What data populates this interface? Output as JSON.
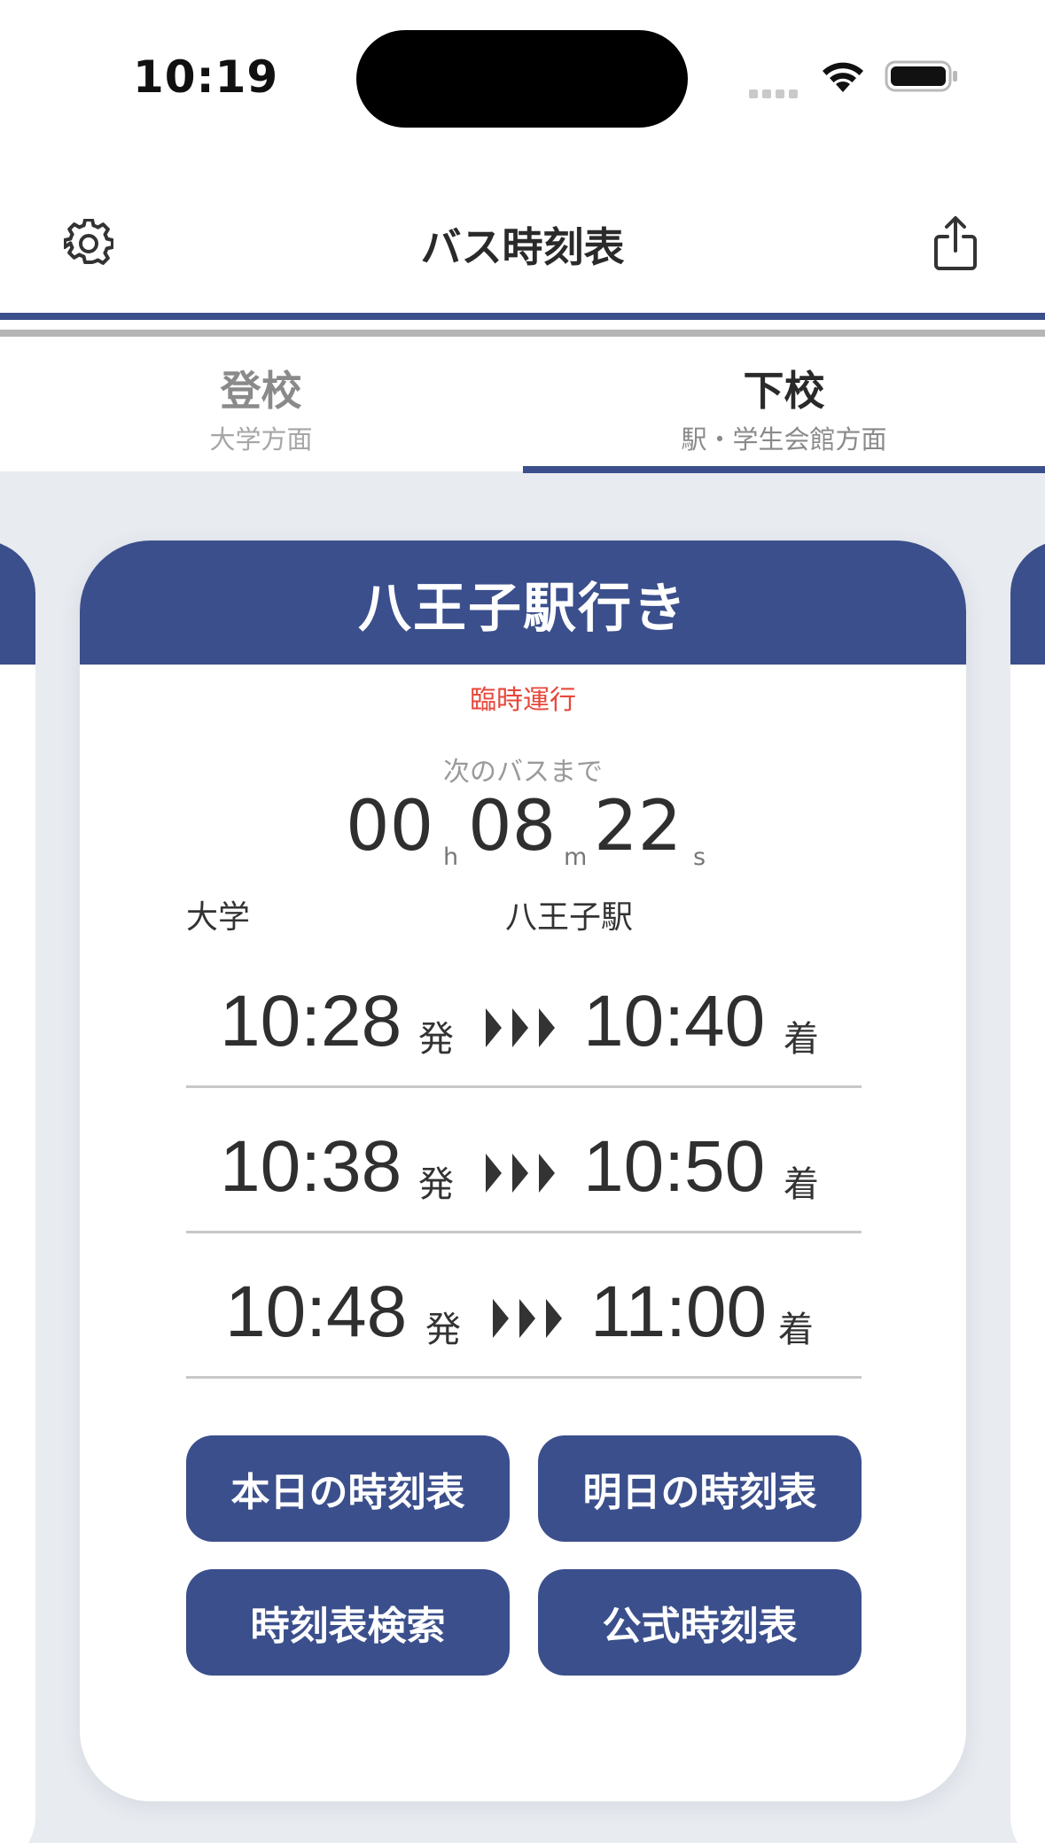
{
  "status_bar": {
    "time": "10:19"
  },
  "nav": {
    "title": "バス時刻表"
  },
  "tabs": [
    {
      "title": "登校",
      "subtitle": "大学方面",
      "selected": false
    },
    {
      "title": "下校",
      "subtitle": "駅・学生会館方面",
      "selected": true
    }
  ],
  "card": {
    "title": "八王子駅行き",
    "notice": "臨時運行",
    "next_label": "次のバスまで",
    "countdown": {
      "hours": "00",
      "hours_unit": "h",
      "minutes": "08",
      "minutes_unit": "m",
      "seconds": "22",
      "seconds_unit": "s"
    },
    "from": "大学",
    "to": "八王子駅",
    "departure_mark": "発",
    "arrival_mark": "着",
    "departures": [
      {
        "depart": "10:28",
        "arrive": "10:40"
      },
      {
        "depart": "10:38",
        "arrive": "10:50"
      },
      {
        "depart": "10:48",
        "arrive": "11:00"
      }
    ],
    "buttons": {
      "today": "本日の時刻表",
      "tomorrow": "明日の時刻表",
      "search": "時刻表検索",
      "official": "公式時刻表"
    }
  },
  "colors": {
    "accent": "#3b4f8c",
    "notice": "#e8473a",
    "background": "#e8ebf0"
  }
}
